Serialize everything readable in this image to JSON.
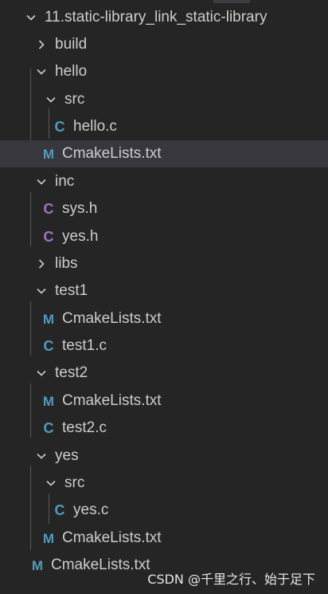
{
  "explorer": {
    "root_folder": "11.static-library_link_static-library",
    "rows": [
      {
        "label": "build"
      },
      {
        "label": "hello"
      },
      {
        "label": "src"
      },
      {
        "label": "hello.c",
        "icon": "c-file-icon"
      },
      {
        "label": "CmakeLists.txt",
        "icon": "cmake-m-icon"
      },
      {
        "label": "inc"
      },
      {
        "label": "sys.h",
        "icon": "c-header-icon"
      },
      {
        "label": "yes.h",
        "icon": "c-header-icon"
      },
      {
        "label": "libs"
      },
      {
        "label": "test1"
      },
      {
        "label": "CmakeLists.txt",
        "icon": "cmake-m-icon"
      },
      {
        "label": "test1.c",
        "icon": "c-file-icon"
      },
      {
        "label": "test2"
      },
      {
        "label": "CmakeLists.txt",
        "icon": "cmake-m-icon"
      },
      {
        "label": "test2.c",
        "icon": "c-file-icon"
      },
      {
        "label": "yes"
      },
      {
        "label": "src"
      },
      {
        "label": "yes.c",
        "icon": "c-file-icon"
      },
      {
        "label": "CmakeLists.txt",
        "icon": "cmake-m-icon"
      },
      {
        "label": "CmakeLists.txt",
        "icon": "cmake-m-icon"
      }
    ],
    "selected_row": "hello/CmakeLists.txt"
  },
  "icons": {
    "c_glyph": "C",
    "m_glyph": "M"
  },
  "colors": {
    "background": "#252526",
    "text": "#cccccc",
    "selected": "#37373d",
    "c_file": "#519aba",
    "h_file": "#a074c4",
    "cmake": "#519aba"
  },
  "watermark": "CSDN @千里之行、始于足下"
}
